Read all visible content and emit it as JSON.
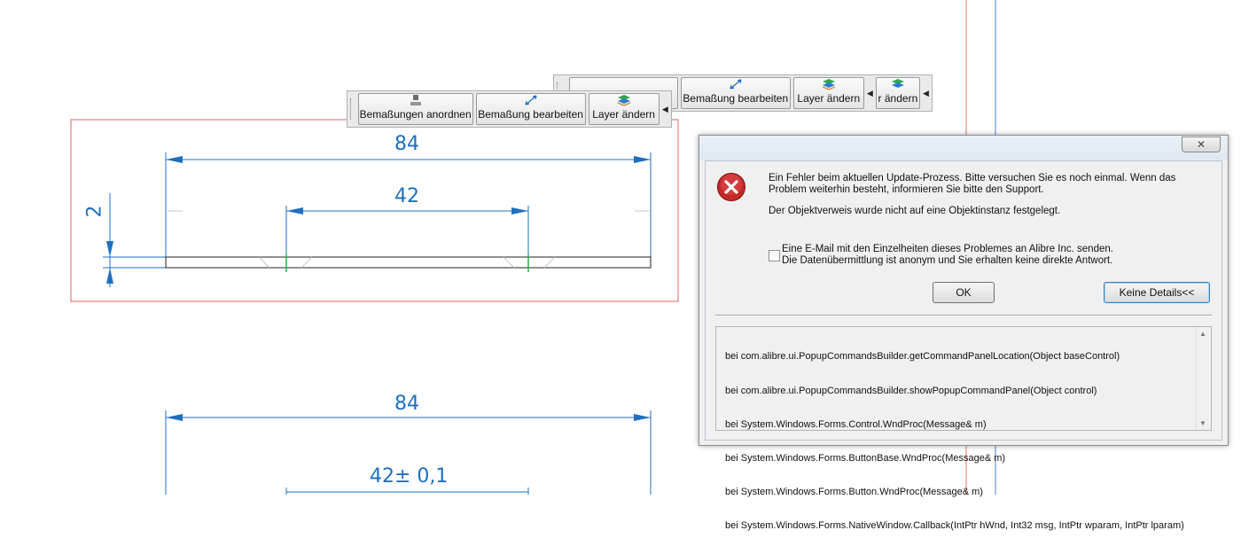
{
  "drawing": {
    "top_view": {
      "total_width": "84",
      "inner_width": "42",
      "height": "2"
    },
    "bottom_view": {
      "total_width": "84",
      "inner_width": "42± 0,1"
    },
    "colors": {
      "dimension": "#1e6fc0",
      "frame": "#e06060",
      "geometry": "#222222",
      "accent": "#27b34a"
    }
  },
  "toolbar_front": {
    "buttons": [
      {
        "label": "Bemaßungen anordnen",
        "icon": "arrange-dimensions-icon"
      },
      {
        "label": "Bemaßung bearbeiten",
        "icon": "edit-dimension-icon"
      },
      {
        "label": "Layer ändern",
        "icon": "layers-icon"
      }
    ]
  },
  "toolbar_back": {
    "buttons": [
      {
        "label": "Bemaßung bearbeiten",
        "icon": "edit-dimension-icon"
      },
      {
        "label": "Layer ändern",
        "icon": "layers-icon"
      },
      {
        "label": "r ändern",
        "icon": "layers-icon"
      }
    ]
  },
  "dialog": {
    "close_glyph": "✕",
    "message_line1": "Ein Fehler beim aktuellen Update-Prozess. Bitte versuchen Sie es noch einmal. Wenn das",
    "message_line2": "Problem weiterhin besteht, informieren Sie bitte den Support.",
    "message_detail": "Der Objektverweis wurde nicht auf eine Objektinstanz festgelegt.",
    "checkbox_line1": "Eine E-Mail mit den Einzelheiten dieses Problemes an Alibre Inc. senden.",
    "checkbox_line2": "Die Datenübermittlung ist anonym und Sie erhalten keine direkte Antwort.",
    "checkbox_checked": false,
    "ok_label": "OK",
    "details_label": "Keine Details<<",
    "stack_trace": [
      "bei com.alibre.ui.PopupCommandsBuilder.getCommandPanelLocation(Object baseControl)",
      "bei com.alibre.ui.PopupCommandsBuilder.showPopupCommandPanel(Object control)",
      "bei System.Windows.Forms.Control.WndProc(Message& m)",
      "bei System.Windows.Forms.ButtonBase.WndProc(Message& m)",
      "bei System.Windows.Forms.Button.WndProc(Message& m)",
      "bei System.Windows.Forms.NativeWindow.Callback(IntPtr hWnd, Int32 msg, IntPtr wparam, IntPtr lparam)"
    ]
  }
}
